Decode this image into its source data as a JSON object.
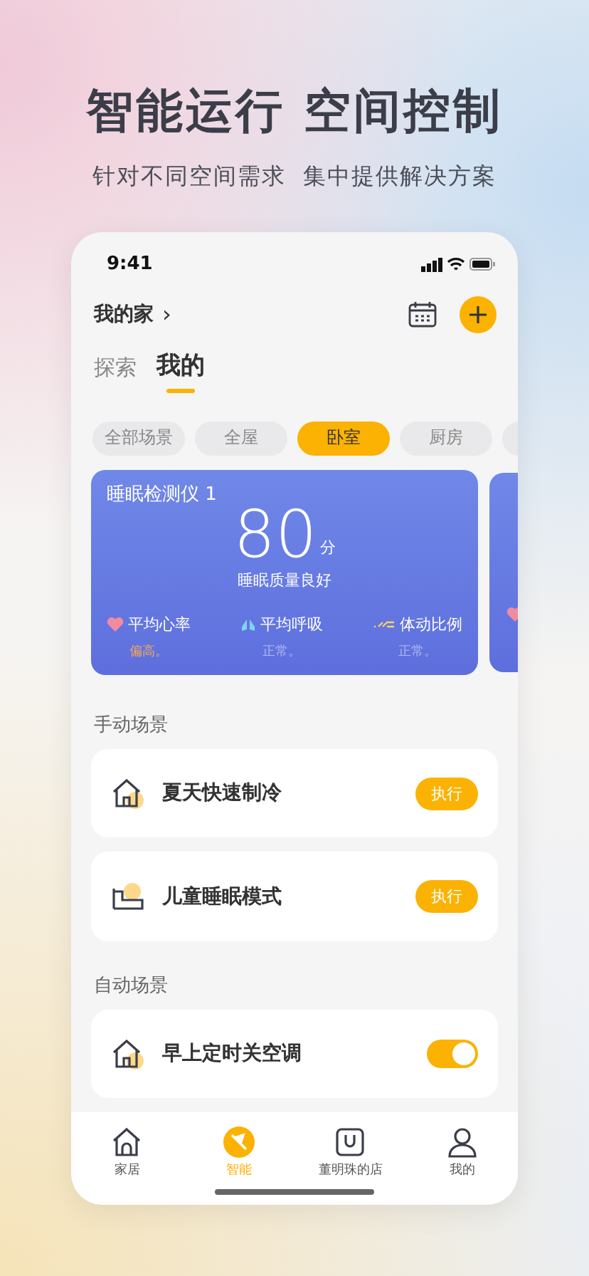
{
  "headline": "智能运行 空间控制",
  "subheadline": "针对不同空间需求  集中提供解决方案",
  "status_bar": {
    "time": "9:41"
  },
  "home": {
    "title": "我的家",
    "chevron": "›"
  },
  "tabs": [
    {
      "label": "探索",
      "selected": false
    },
    {
      "label": "我的",
      "selected": true
    }
  ],
  "chips": [
    {
      "label": "全部场景",
      "selected": false
    },
    {
      "label": "全屋",
      "selected": false
    },
    {
      "label": "卧室",
      "selected": true
    },
    {
      "label": "厨房",
      "selected": false
    }
  ],
  "device": {
    "name": "睡眠检测仪 1",
    "score": "80",
    "unit": "分",
    "quality": "睡眠质量良好",
    "metrics": [
      {
        "kind": "heart",
        "label": "平均心率",
        "value": "偏高。",
        "alert": true
      },
      {
        "kind": "lungs",
        "label": "平均呼吸",
        "value": "正常。",
        "alert": false
      },
      {
        "kind": "motion",
        "label": "体动比例",
        "value": "正常。",
        "alert": false
      }
    ]
  },
  "manual_title": "手动场景",
  "manual_scenes": [
    {
      "kind": "house",
      "name": "夏天快速制冷",
      "action": "执行"
    },
    {
      "kind": "bed",
      "name": "儿童睡眠模式",
      "action": "执行"
    }
  ],
  "auto_title": "自动场景",
  "auto_scenes": [
    {
      "kind": "house",
      "name": "早上定时关空调",
      "on": true
    }
  ],
  "nav": [
    {
      "kind": "home",
      "label": "家居",
      "selected": false
    },
    {
      "kind": "smart",
      "label": "智能",
      "selected": true
    },
    {
      "kind": "bag",
      "label": "董明珠的店",
      "selected": false
    },
    {
      "kind": "person",
      "label": "我的",
      "selected": false
    }
  ]
}
